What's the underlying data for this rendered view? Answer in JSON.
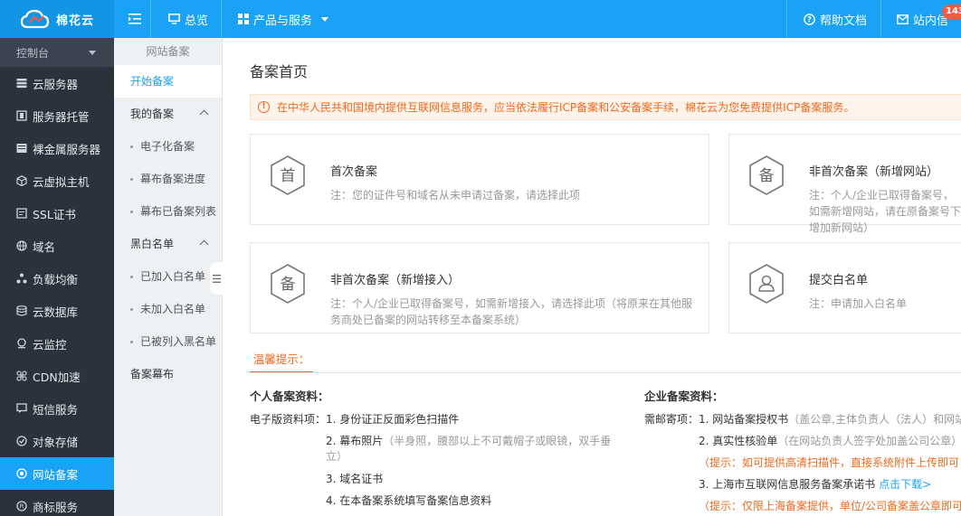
{
  "header": {
    "logo_text": "棉花云",
    "nav": [
      {
        "label": "总览"
      },
      {
        "label": "产品与服务"
      }
    ],
    "help_label": "帮助文档",
    "mail_label": "站内信",
    "mail_badge": "143"
  },
  "sidebar": {
    "console_label": "控制台",
    "items": [
      {
        "label": "云服务器",
        "icon": "server-icon"
      },
      {
        "label": "服务器托管",
        "icon": "hosting-icon"
      },
      {
        "label": "裸金属服务器",
        "icon": "bare-metal-icon"
      },
      {
        "label": "云虚拟主机",
        "icon": "cube-icon"
      },
      {
        "label": "SSL证书",
        "icon": "certificate-icon"
      },
      {
        "label": "域名",
        "icon": "globe-icon"
      },
      {
        "label": "负载均衡",
        "icon": "load-balance-icon"
      },
      {
        "label": "云数据库",
        "icon": "database-icon"
      },
      {
        "label": "云监控",
        "icon": "monitor-icon"
      },
      {
        "label": "CDN加速",
        "icon": "cdn-icon"
      },
      {
        "label": "短信服务",
        "icon": "sms-icon"
      },
      {
        "label": "对象存储",
        "icon": "storage-icon"
      },
      {
        "label": "网站备案",
        "icon": "record-icon",
        "active": true
      },
      {
        "label": "商标服务",
        "icon": "trademark-icon"
      }
    ]
  },
  "subnav": {
    "title": "网站备案",
    "start": "开始备案",
    "my_records": "我的备案",
    "my_children": [
      "电子化备案",
      "幕布备案进度",
      "幕布已备案列表"
    ],
    "blackwhite": "黑白名单",
    "bw_children": [
      "已加入白名单",
      "未加入白名单",
      "已被列入黑名单"
    ],
    "curtain": "备案幕布"
  },
  "main": {
    "title": "备案首页",
    "notice": "在中华人民共和国境内提供互联网信息服务，应当依法履行ICP备案和公安备案手续，棉花云为您免费提供ICP备案服务。",
    "cards": [
      {
        "icon_char": "首",
        "title": "首次备案",
        "desc": "注：您的证件号和域名从未申请过备案，请选择此项"
      },
      {
        "icon_char": "备",
        "title": "非首次备案（新增网站）",
        "desc": "注：个人/企业已取得备案号，如需新增网站，请在原备案号下增加新网站）"
      },
      {
        "icon_char": "备",
        "title": "非首次备案（新增接入）",
        "desc": "注：个人/企业已取得备案号，如需新增接入，请选择此项（将原来在其他服务商处已备案的网站转移至本备案系统）"
      },
      {
        "icon_char": "",
        "title": "提交白名单",
        "desc": "注：申请加入白名单"
      }
    ],
    "tip_tab": "温馨提示：",
    "personal": {
      "title": "个人备案资料：",
      "prefix": "电子版资料项：",
      "items": [
        {
          "main": "1. 身份证正反面彩色扫描件"
        },
        {
          "main": "2. 幕布照片",
          "note": "（半身照，腰部以上不可戴帽子或眼镜，双手垂立）"
        },
        {
          "main": "3. 域名证书"
        },
        {
          "main": "4. 在本备案系统填写备案信息资料"
        }
      ]
    },
    "company": {
      "title": "企业备案资料：",
      "prefix": "需邮寄项：",
      "item1_main": "1. 网站备案授权书",
      "item1_note": "（盖公章,主体负责人（法人）和网站",
      "item2_main": "2. 真实性核验单",
      "item2_note": "（在网站负责人签字处加盖公司公章）",
      "tip1": "（提示：如可提供高清扫描件，直接系统附件上传即可",
      "item3_main": "3. 上海市互联网信息服务备案承诺书",
      "item3_link": "点击下载>",
      "tip2": "（提示：仅限上海备案提供，单位/公司备案盖公章即可"
    }
  }
}
